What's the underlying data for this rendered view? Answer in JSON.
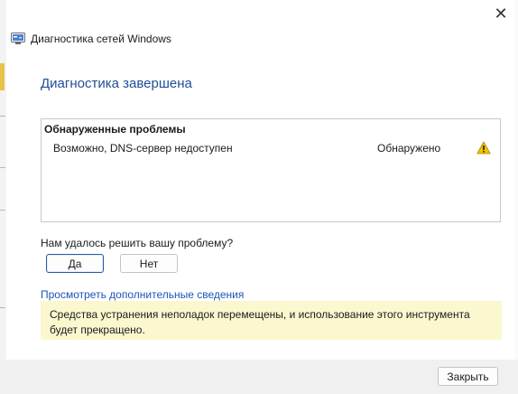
{
  "window": {
    "title": "Диагностика сетей Windows",
    "close_glyph": "✕"
  },
  "main": {
    "heading": "Диагностика завершена",
    "problems": {
      "header": "Обнаруженные проблемы",
      "rows": [
        {
          "description": "Возможно, DNS-сервер недоступен",
          "status": "Обнаружено",
          "icon": "warning-icon"
        }
      ]
    },
    "question": "Нам удалось решить вашу проблему?",
    "yes_label": "Да",
    "no_label": "Нет",
    "more_info_link": "Просмотреть дополнительные сведения",
    "notice": "Средства устранения неполадок перемещены, и использование этого инструмента будет прекращено."
  },
  "footer": {
    "close_label": "Закрыть"
  },
  "colors": {
    "heading": "#1f4d96",
    "link": "#1a56b8",
    "notice_bg": "#fbf7cf",
    "warning": "#f2c200"
  }
}
